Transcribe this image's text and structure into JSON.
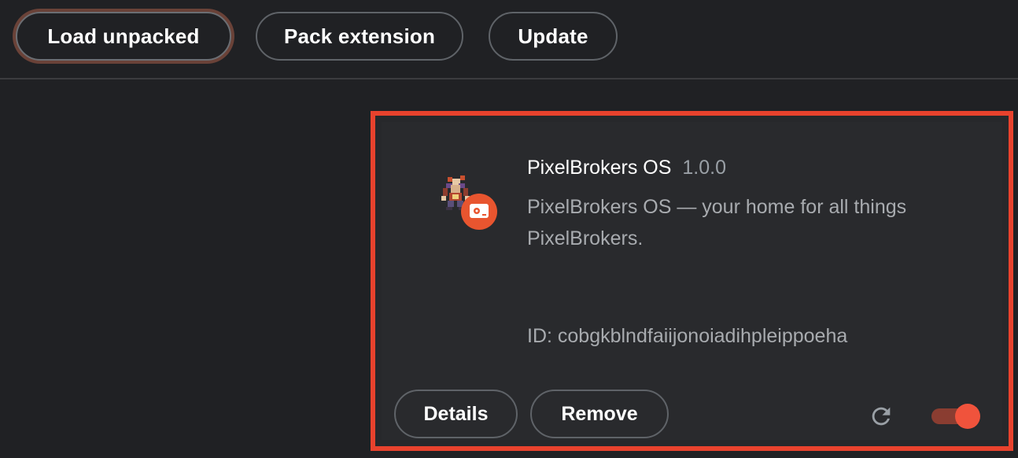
{
  "toolbar": {
    "load_unpacked": "Load unpacked",
    "pack_extension": "Pack extension",
    "update": "Update"
  },
  "extension": {
    "name": "PixelBrokers OS",
    "version": "1.0.0",
    "description": "PixelBrokers OS — your home for all things PixelBrokers.",
    "id_text": "ID: cobgkblndfaiijonoiadihpleippoeha",
    "details_label": "Details",
    "remove_label": "Remove",
    "enabled": true,
    "icon": "pixel-character-icon",
    "badge_icon": "hard-drive-icon",
    "reload_icon": "reload-icon"
  },
  "colors": {
    "background": "#202124",
    "card": "#292a2d",
    "highlight_border": "#e8422d",
    "toggle_on": "#f0533c"
  }
}
